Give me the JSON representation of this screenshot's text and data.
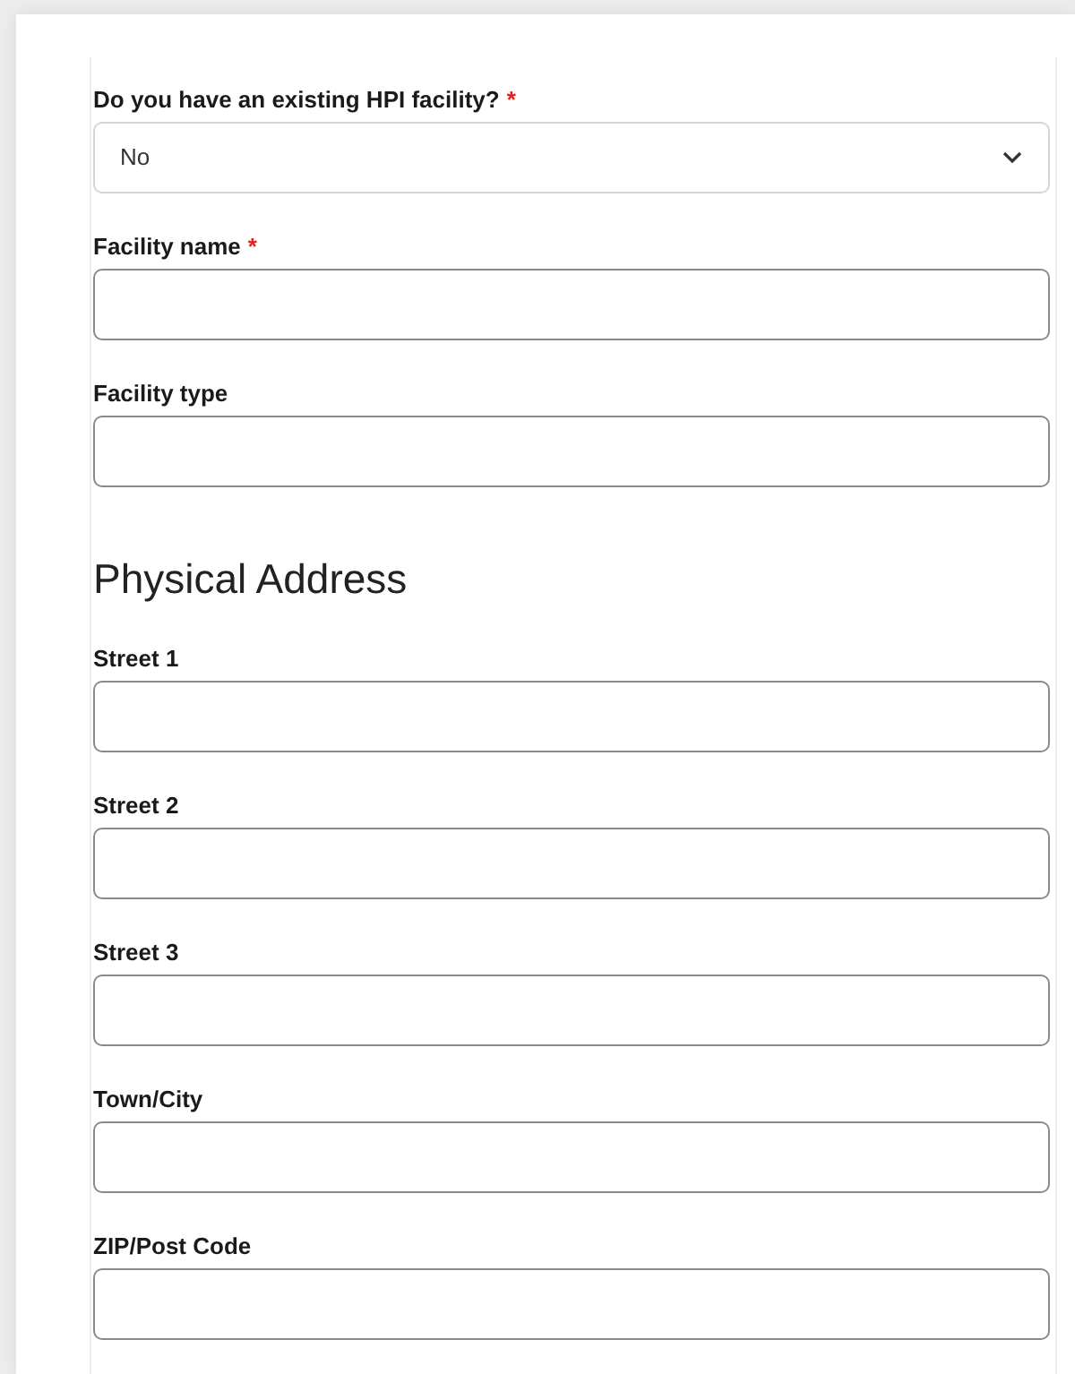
{
  "form": {
    "items": [
      {
        "kind": "select",
        "label": "Do you have an existing HPI facility?",
        "required_mark": "*",
        "value": "No"
      },
      {
        "kind": "input",
        "label": "Facility name",
        "required_mark": "*"
      },
      {
        "kind": "input",
        "label": "Facility type"
      },
      {
        "kind": "heading",
        "label": "Physical Address"
      },
      {
        "kind": "input",
        "label": "Street 1"
      },
      {
        "kind": "input",
        "label": "Street 2"
      },
      {
        "kind": "input",
        "label": "Street 3"
      },
      {
        "kind": "input",
        "label": "Town/City"
      },
      {
        "kind": "input",
        "label": "ZIP/Post Code"
      }
    ]
  }
}
